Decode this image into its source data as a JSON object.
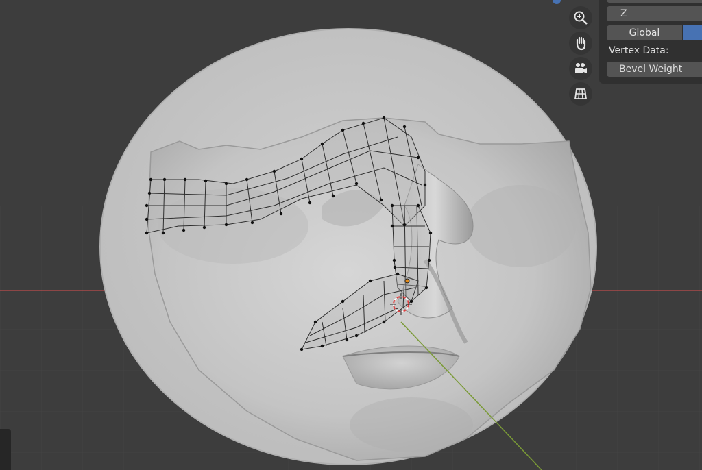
{
  "panel": {
    "axis_z_label": "Z",
    "orientation_global": "Global",
    "vertex_data_label": "Vertex Data:",
    "vertex_data_value": "Bevel Weight"
  },
  "navigation": {
    "icons": [
      "zoom-icon",
      "pan-hand-icon",
      "camera-icon",
      "ortho-grid-icon"
    ]
  },
  "colors": {
    "viewport_bg": "#3d3d3d",
    "mesh_surface": "#c5c5c5",
    "x_axis": "#a84a4a",
    "y_axis": "#7a9a36",
    "accent_blue": "#4772b3",
    "origin_dot": "#e08a1a"
  }
}
